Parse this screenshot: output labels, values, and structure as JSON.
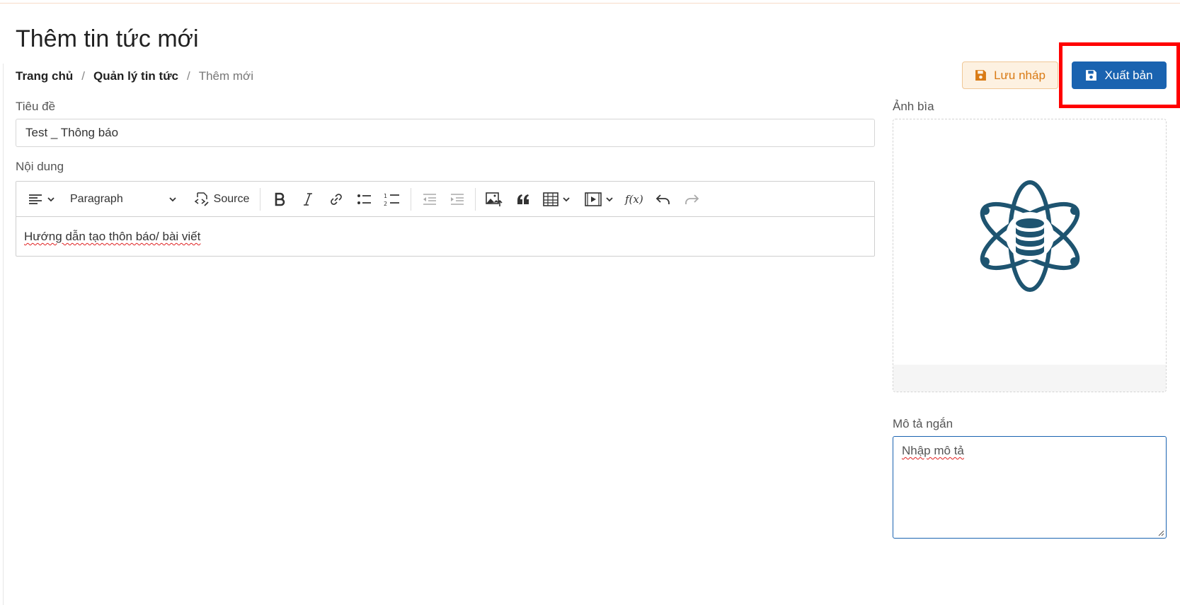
{
  "page": {
    "title": "Thêm tin tức mới"
  },
  "breadcrumb": {
    "items": [
      "Trang chủ",
      "Quản lý tin tức",
      "Thêm mới"
    ],
    "separator": "/"
  },
  "actions": {
    "draft_label": "Lưu nháp",
    "publish_label": "Xuất bản"
  },
  "form": {
    "title_label": "Tiêu đề",
    "title_value": "Test _ Thông báo",
    "content_label": "Nội dung",
    "content_value": "Hướng dẫn tạo thôn báo/ bài viết",
    "cover_label": "Ảnh bìa",
    "summary_label": "Mô tả ngắn",
    "summary_placeholder": "Nhập mô tả"
  },
  "toolbar": {
    "paragraph_label": "Paragraph",
    "source_label": "Source",
    "icons": [
      "align-left-icon",
      "chevron-down-icon",
      "source-icon",
      "bold-icon",
      "italic-icon",
      "link-icon",
      "bullet-list-icon",
      "numbered-list-icon",
      "outdent-icon",
      "indent-icon",
      "image-upload-icon",
      "blockquote-icon",
      "table-icon",
      "media-embed-icon",
      "math-formula-icon",
      "undo-icon",
      "redo-icon"
    ]
  },
  "colors": {
    "primary": "#1a63b0",
    "draft_text": "#d97a14",
    "draft_bg": "#fdf1e1",
    "highlight": "#ff0000",
    "cover_icon": "#1e5470"
  }
}
